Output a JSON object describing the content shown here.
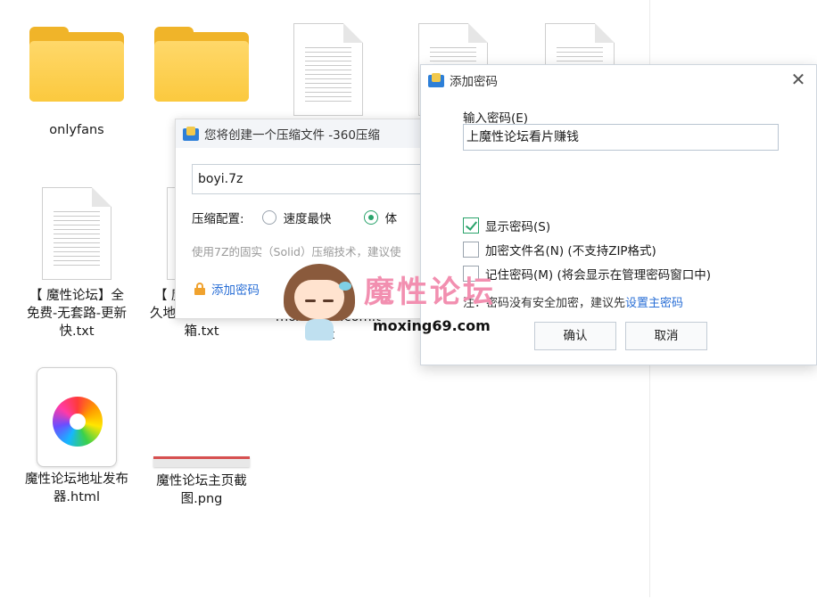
{
  "explorer": {
    "files": [
      {
        "name": "onlyfans",
        "type": "folder"
      },
      {
        "name": "",
        "type": "folder"
      },
      {
        "name": "",
        "type": "text"
      },
      {
        "name": "",
        "type": "text"
      },
      {
        "name": "",
        "type": "text"
      },
      {
        "name": "【 魔性论坛】全免费-无套路-更新快.txt",
        "type": "text"
      },
      {
        "name": "【 魔性论坛】永久地址发布页及邮箱.txt",
        "type": "text"
      },
      {
        "name": "moxing69.com.txt",
        "type": "text"
      },
      {
        "name": "魔性论坛地址发布器.html",
        "type": "html"
      },
      {
        "name": "魔性论坛主页截图.png",
        "type": "image"
      }
    ]
  },
  "dialog360": {
    "title": "您将创建一个压缩文件 -360压缩",
    "filename": "boyi.7z",
    "config_label": "压缩配置:",
    "option_fast": "速度最快",
    "option_small": "体",
    "hint": "使用7Z的固实（Solid）压缩技术，建议使",
    "add_password": "添加密码"
  },
  "password_dialog": {
    "title": "添加密码",
    "input_label": "输入密码(E)",
    "password_value": "上魔性论坛看片赚钱",
    "show_password": "显示密码(S)",
    "encrypt_filenames": "加密文件名(N) (不支持ZIP格式)",
    "remember_password": "记住密码(M) (将会显示在管理密码窗口中)",
    "note": "注：密码没有安全加密，建议先",
    "note_link": "设置主密码",
    "ok": "确认",
    "cancel": "取消",
    "show_password_checked": true,
    "encrypt_filenames_checked": false,
    "remember_password_checked": false
  },
  "watermark": {
    "brand": "魔性论坛",
    "site": "moxing69.com"
  },
  "colors": {
    "link": "#2a6fd6",
    "check": "#2aa36b",
    "folder": "#f0b429",
    "watermark": "#f28fb0"
  }
}
